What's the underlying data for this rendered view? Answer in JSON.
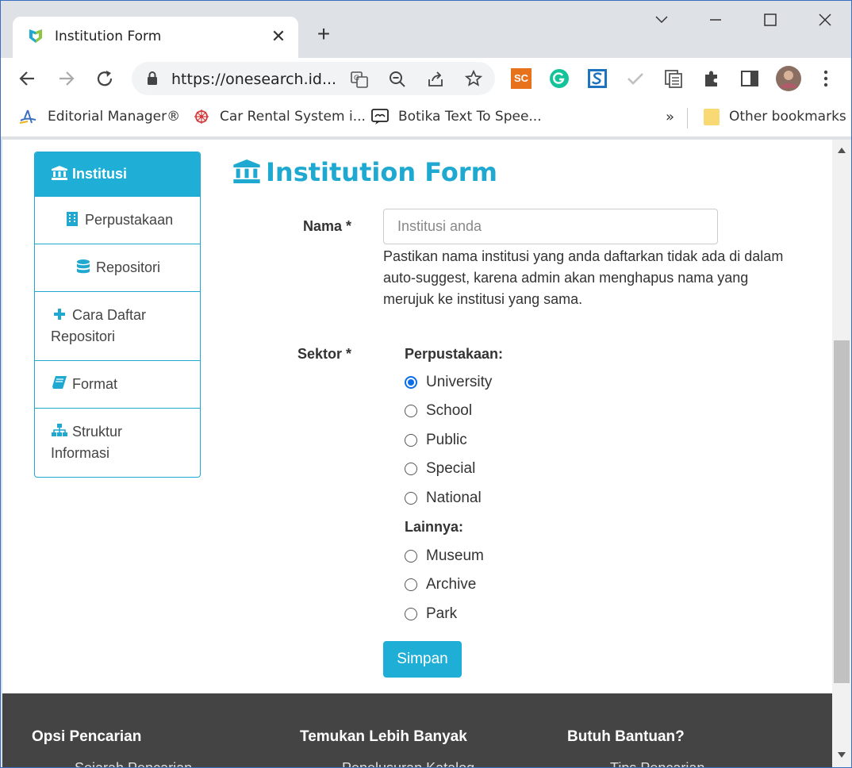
{
  "browser": {
    "tab_title": "Institution Form",
    "tab_close": "✕",
    "new_tab": "+",
    "url": "https://onesearch.id...",
    "bookmarks": [
      {
        "label": "Editorial Manager®"
      },
      {
        "label": "Car Rental System i..."
      },
      {
        "label": "Botika Text To Spee..."
      }
    ],
    "bookmarks_overflow": "»",
    "other_bookmarks": "Other bookmarks",
    "ext_sc_label": "SC"
  },
  "sidebar": {
    "items": [
      {
        "label": "Institusi",
        "icon": "bank-icon"
      },
      {
        "label": "Perpustakaan",
        "icon": "building-icon"
      },
      {
        "label": "Repositori",
        "icon": "database-icon"
      },
      {
        "label_line1": "Cara Daftar",
        "label_line2": "Repositori",
        "icon": "plus-icon"
      },
      {
        "label": "Format",
        "icon": "book-icon"
      },
      {
        "label_line1": "Struktur",
        "label_line2": "Informasi",
        "icon": "sitemap-icon"
      }
    ]
  },
  "form": {
    "title": "Institution Form",
    "nama_label": "Nama *",
    "nama_placeholder": "Institusi anda",
    "nama_help": "Pastikan nama institusi yang anda daftarkan tidak ada di dalam auto-suggest, karena admin akan menghapus nama yang merujuk ke institusi yang sama.",
    "sektor_label": "Sektor *",
    "group1": "Perpustakaan:",
    "options1": [
      "University",
      "School",
      "Public",
      "Special",
      "National"
    ],
    "selected": "University",
    "group2": "Lainnya:",
    "options2": [
      "Museum",
      "Archive",
      "Park"
    ],
    "submit": "Simpan"
  },
  "footer": {
    "col1": "Opsi Pencarian",
    "col2": "Temukan Lebih Banyak",
    "col3": "Butuh Bantuan?",
    "link1": "Sejarah Pencarian",
    "link2": "Penelusuran Katalog",
    "link3": "Tips Pencarian"
  },
  "colors": {
    "accent": "#1faed6",
    "footer_bg": "#444444",
    "radio_checked": "#0b6ee8"
  }
}
